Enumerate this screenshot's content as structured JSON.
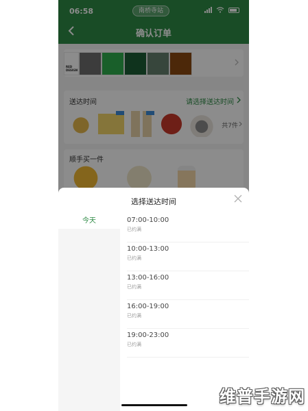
{
  "status_bar": {
    "time": "06:58",
    "location": "南桥寺站"
  },
  "nav": {
    "title": "确认订单"
  },
  "color_strip": {
    "logo_text": "RED DESIGN",
    "swatches": [
      "#6e6e6e",
      "#2fae4e",
      "#1d5d35",
      "#64806e",
      "#8b4a12"
    ]
  },
  "delivery": {
    "title": "送达时间",
    "select_label": "请选择送达时间",
    "count_label": "共7件"
  },
  "extra": {
    "title": "顺手买一件"
  },
  "sheet": {
    "title": "选择送达时间",
    "day_label": "今天",
    "slots": [
      {
        "time": "07:00-10:00",
        "status": "已约满"
      },
      {
        "time": "10:00-13:00",
        "status": "已约满"
      },
      {
        "time": "13:00-16:00",
        "status": "已约满"
      },
      {
        "time": "16:00-19:00",
        "status": "已约满"
      },
      {
        "time": "19:00-23:00",
        "status": "已约满"
      }
    ]
  },
  "watermark": "维普手游网",
  "colors": {
    "brand_green": "#2e8b45",
    "dim_overlay": "rgba(0,0,0,0.45)"
  }
}
